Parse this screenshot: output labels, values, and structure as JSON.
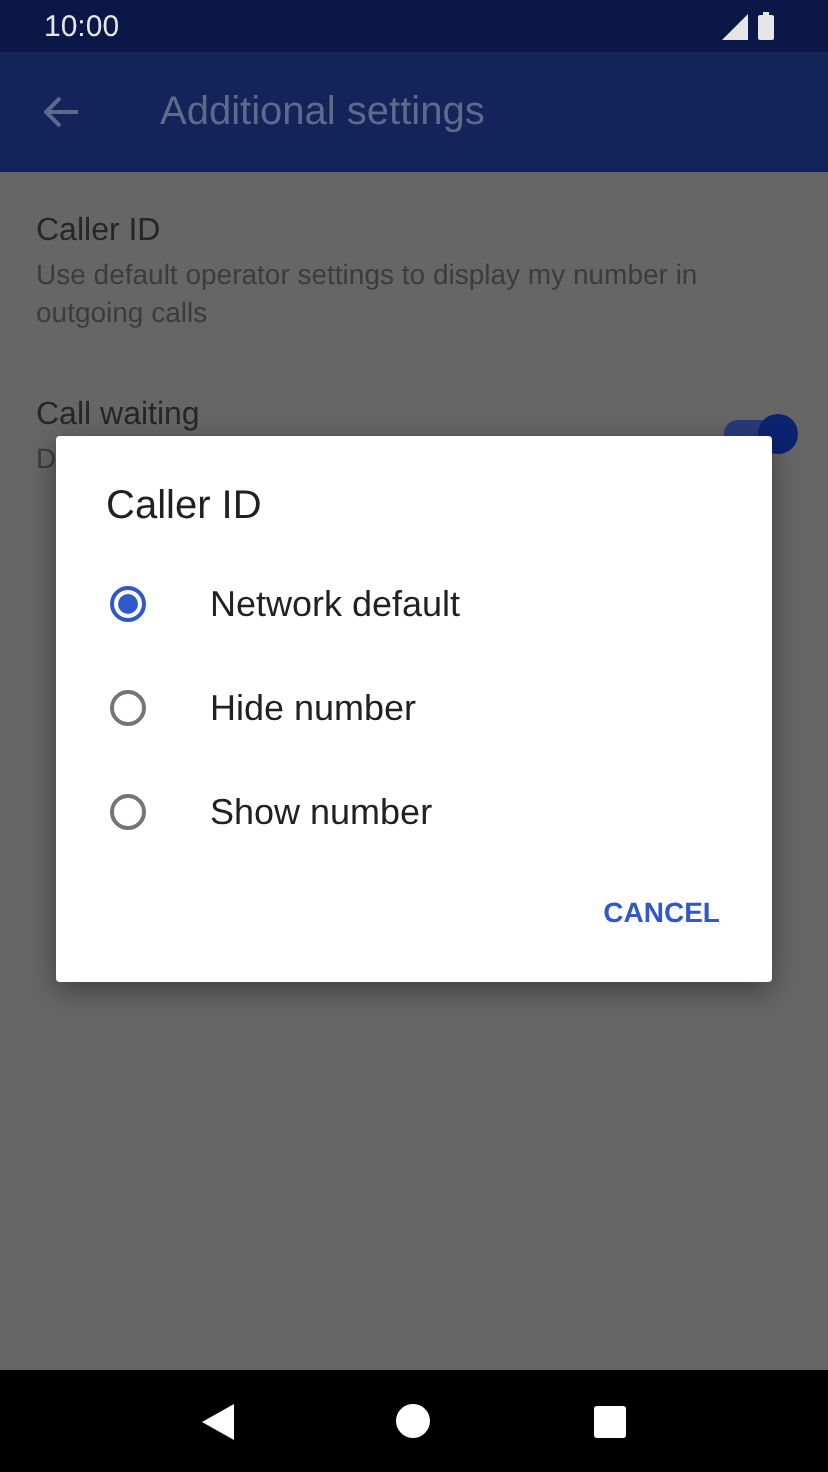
{
  "status_bar": {
    "time": "10:00"
  },
  "app_bar": {
    "title": "Additional settings"
  },
  "settings": [
    {
      "title": "Caller ID",
      "summary": "Use default operator settings to display my number in outgoing calls",
      "kind": "text"
    },
    {
      "title": "Call waiting",
      "summary": "D",
      "kind": "switch",
      "on": true
    }
  ],
  "dialog": {
    "title": "Caller ID",
    "options": [
      {
        "label": "Network default",
        "selected": true
      },
      {
        "label": "Hide number",
        "selected": false
      },
      {
        "label": "Show number",
        "selected": false
      }
    ],
    "buttons": [
      "CANCEL"
    ]
  }
}
